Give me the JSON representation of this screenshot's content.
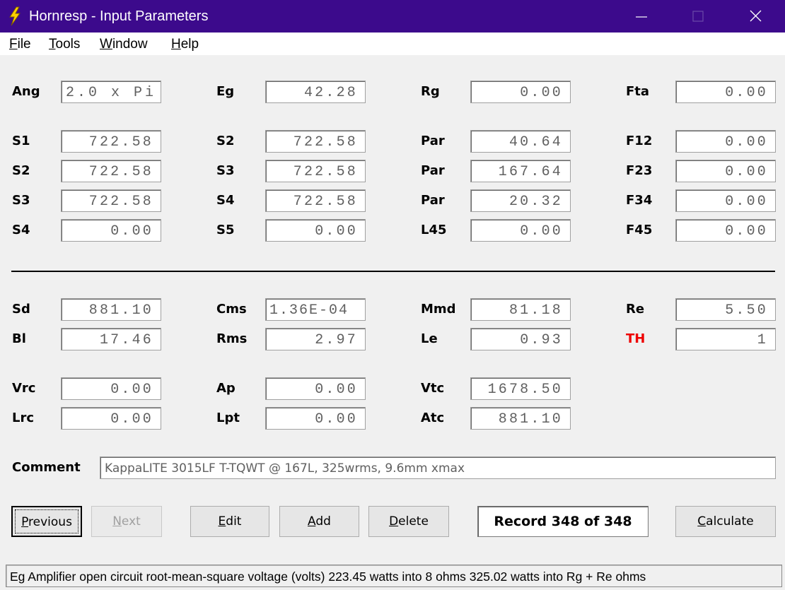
{
  "window": {
    "title": "Hornresp - Input Parameters",
    "icon": "lightning-bolt-icon"
  },
  "menu": [
    {
      "first": "F",
      "rest": "ile"
    },
    {
      "first": "T",
      "rest": "ools"
    },
    {
      "first": "W",
      "rest": "indow"
    },
    {
      "first": "H",
      "rest": "elp"
    }
  ],
  "horn": {
    "ang": {
      "label": "Ang",
      "value": "2.0 x Pi"
    },
    "eg": {
      "label": "Eg",
      "value": "42.28"
    },
    "rg": {
      "label": "Rg",
      "value": "0.00"
    },
    "fta": {
      "label": "Fta",
      "value": "0.00"
    },
    "rows": [
      {
        "a_label": "S1",
        "a": "722.58",
        "b_label": "S2",
        "b": "722.58",
        "c_label": "Par",
        "c": "40.64",
        "d_label": "F12",
        "d": "0.00"
      },
      {
        "a_label": "S2",
        "a": "722.58",
        "b_label": "S3",
        "b": "722.58",
        "c_label": "Par",
        "c": "167.64",
        "d_label": "F23",
        "d": "0.00"
      },
      {
        "a_label": "S3",
        "a": "722.58",
        "b_label": "S4",
        "b": "722.58",
        "c_label": "Par",
        "c": "20.32",
        "d_label": "F34",
        "d": "0.00"
      },
      {
        "a_label": "S4",
        "a": "0.00",
        "b_label": "S5",
        "b": "0.00",
        "c_label": "L45",
        "c": "0.00",
        "d_label": "F45",
        "d": "0.00"
      }
    ]
  },
  "driver": {
    "sd": {
      "label": "Sd",
      "value": "881.10"
    },
    "cms": {
      "label": "Cms",
      "value": "1.36E-04"
    },
    "mmd": {
      "label": "Mmd",
      "value": "81.18"
    },
    "re": {
      "label": "Re",
      "value": "5.50"
    },
    "bl": {
      "label": "Bl",
      "value": "17.46"
    },
    "rms": {
      "label": "Rms",
      "value": "2.97"
    },
    "le": {
      "label": "Le",
      "value": "0.93"
    },
    "th": {
      "label": "TH",
      "value": "1",
      "color": "#ee0000"
    }
  },
  "chambers": {
    "vrc": {
      "label": "Vrc",
      "value": "0.00"
    },
    "ap": {
      "label": "Ap",
      "value": "0.00"
    },
    "vtc": {
      "label": "Vtc",
      "value": "1678.50"
    },
    "lrc": {
      "label": "Lrc",
      "value": "0.00"
    },
    "lpt": {
      "label": "Lpt",
      "value": "0.00"
    },
    "atc": {
      "label": "Atc",
      "value": "881.10"
    }
  },
  "comment": {
    "label": "Comment",
    "value": "KappaLITE 3015LF T-TQWT @ 167L, 325wrms, 9.6mm xmax"
  },
  "buttons": {
    "previous": {
      "first": "P",
      "rest": "revious"
    },
    "next": {
      "first": "N",
      "rest": "ext"
    },
    "edit": {
      "first": "E",
      "rest": "dit"
    },
    "add": {
      "first": "A",
      "rest": "dd"
    },
    "delete": {
      "first": "D",
      "rest": "elete"
    },
    "calculate": {
      "first": "C",
      "rest": "alculate"
    }
  },
  "record": "Record 348 of 348",
  "status": "Eg  Amplifier open circuit root-mean-square voltage  (volts)   223.45 watts into 8 ohms   325.02 watts into Rg + Re ohms"
}
